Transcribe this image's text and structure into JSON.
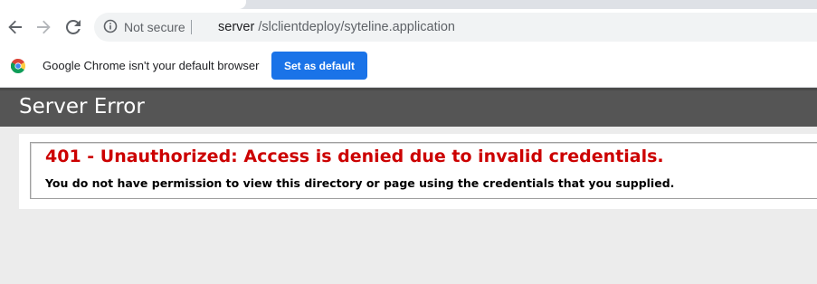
{
  "browser": {
    "security_label": "Not secure",
    "url_host": "server",
    "url_path": " /slclientdeploy/syteline.application",
    "icons": [
      "back-arrow-icon",
      "forward-arrow-icon",
      "reload-icon",
      "info-circle-icon",
      "chrome-logo-icon"
    ]
  },
  "infobar": {
    "message": "Google Chrome isn't your default browser",
    "button_label": "Set as default",
    "button_color": "#1a73e8"
  },
  "page": {
    "header_title": "Server Error",
    "error_title": "401 - Unauthorized: Access is denied due to invalid credentials.",
    "error_description": "You do not have permission to view this directory or page using the credentials that you supplied.",
    "error_color": "#cc0000",
    "header_bg": "#555555"
  }
}
